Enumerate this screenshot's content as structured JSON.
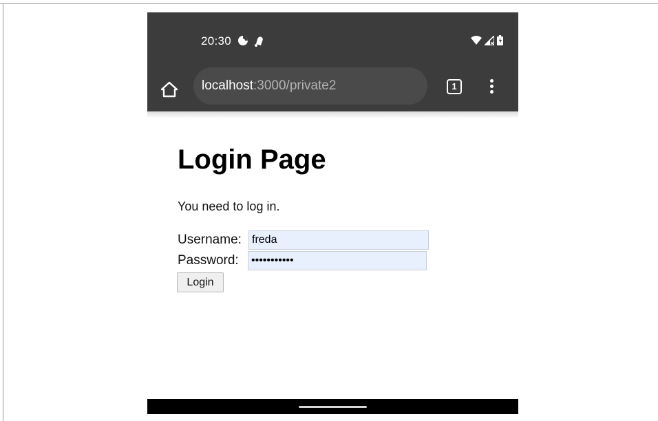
{
  "status_bar": {
    "time": "20:30",
    "left_icons": [
      "data-saver-icon",
      "notification-bell-icon"
    ],
    "right_icons": [
      "wifi-icon",
      "cell-signal-icon",
      "battery-icon"
    ]
  },
  "browser": {
    "url_host": "localhost",
    "url_path": ":3000/private2",
    "tab_count": "1",
    "home_icon": "home-icon",
    "menu_icon": "more-vert-icon"
  },
  "page": {
    "heading": "Login Page",
    "message": "You need to log in.",
    "username_label": "Username:",
    "username_value": "freda",
    "password_label": "Password:",
    "password_value": "passwordabc",
    "login_button": "Login"
  }
}
